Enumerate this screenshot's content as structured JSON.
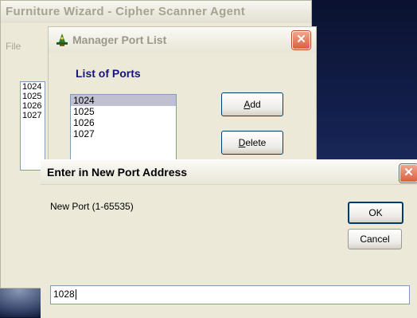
{
  "back_window": {
    "title": "Furniture Wizard - Cipher Scanner Agent",
    "menu_file": "File",
    "list_items": [
      "1024",
      "1025",
      "1026",
      "1027"
    ]
  },
  "manager_window": {
    "title": "Manager Port List",
    "heading": "List of Ports",
    "ports": [
      "1024",
      "1025",
      "1026",
      "1027"
    ],
    "selected_port": "1024",
    "add_label_accel": "A",
    "add_label_rest": "dd",
    "delete_label_accel": "D",
    "delete_label_rest": "elete",
    "close_glyph": "✕"
  },
  "dialog": {
    "title": "Enter in New Port Address",
    "prompt": "New Port (1-65535)",
    "ok_label": "OK",
    "cancel_label": "Cancel",
    "input_value": "1028",
    "close_glyph": "✕"
  },
  "colors": {
    "heading": "#15157a",
    "close_red": "#d9603d",
    "selection": "#c0c0d0"
  }
}
